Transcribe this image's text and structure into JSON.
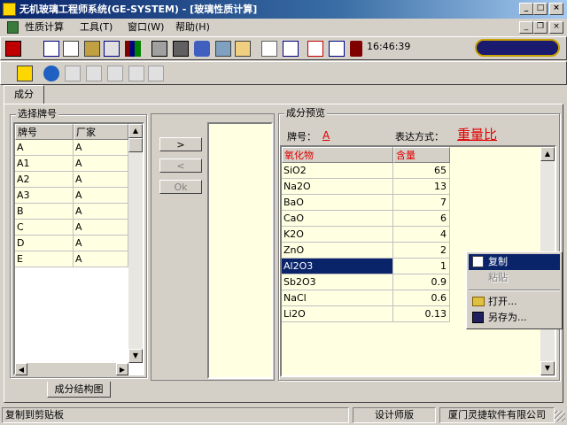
{
  "window": {
    "title": "无机玻璃工程师系统(GE-SYSTEM) - [玻璃性质计算]"
  },
  "menu": [
    "性质计算",
    "工具(T)",
    "窗口(W)",
    "帮助(H)"
  ],
  "toolbar": {
    "clock": "16:46:39"
  },
  "tabs": {
    "top": "成分",
    "bottom": "成分结构图"
  },
  "select_group": {
    "title": "选择牌号",
    "columns": [
      "牌号",
      "厂家"
    ],
    "rows": [
      [
        "A",
        "A"
      ],
      [
        "A1",
        "A"
      ],
      [
        "A2",
        "A"
      ],
      [
        "A3",
        "A"
      ],
      [
        "B",
        "A"
      ],
      [
        "C",
        "A"
      ],
      [
        "D",
        "A"
      ],
      [
        "E",
        "A"
      ]
    ]
  },
  "transfer_buttons": {
    "add": ">",
    "remove": "<",
    "ok": "Ok"
  },
  "preview_group": {
    "title": "成分预览",
    "brand_label": "牌号：",
    "brand_value": "A",
    "mode_label": "表达方式：",
    "mode_value": "重量比",
    "columns": [
      "氧化物",
      "含量"
    ],
    "rows": [
      [
        "SiO2",
        "65"
      ],
      [
        "Na2O",
        "13"
      ],
      [
        "BaO",
        "7"
      ],
      [
        "CaO",
        "6"
      ],
      [
        "K2O",
        "4"
      ],
      [
        "ZnO",
        "2"
      ],
      [
        "Al2O3",
        "1"
      ],
      [
        "Sb2O3",
        "0.9"
      ],
      [
        "NaCl",
        "0.6"
      ],
      [
        "Li2O",
        "0.13"
      ]
    ],
    "selected_row": 6
  },
  "context_menu": {
    "items": [
      "复制",
      "粘贴",
      "打开...",
      "另存为..."
    ]
  },
  "status": {
    "message": "复制到剪贴板",
    "edition": "设计师版",
    "company": "厦门灵捷软件有限公司"
  },
  "colors": {
    "title_gradient_start": "#0a246a",
    "selection": "#0a246a",
    "cream": "#ffffe1",
    "red_value": "#e00000"
  }
}
